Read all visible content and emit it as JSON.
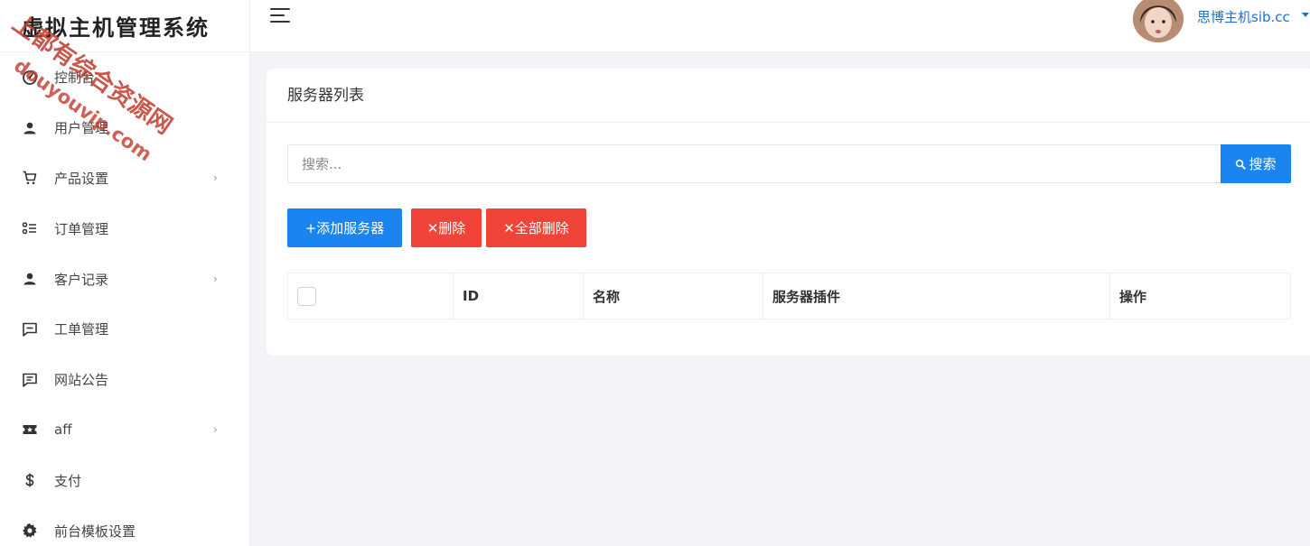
{
  "brand": {
    "title": "虚拟主机管理系统"
  },
  "watermark": {
    "line1": "上都有综合资源网",
    "line2": "douyouvip.com"
  },
  "sidebar": {
    "items": [
      {
        "label": "控制台",
        "icon": "dashboard-icon",
        "has_arrow": false
      },
      {
        "label": "用户管理",
        "icon": "user-icon",
        "has_arrow": false
      },
      {
        "label": "产品设置",
        "icon": "cart-icon",
        "has_arrow": true
      },
      {
        "label": "订单管理",
        "icon": "list-icon",
        "has_arrow": false
      },
      {
        "label": "客户记录",
        "icon": "user-icon",
        "has_arrow": true
      },
      {
        "label": "工单管理",
        "icon": "message-icon",
        "has_arrow": false
      },
      {
        "label": "网站公告",
        "icon": "notice-icon",
        "has_arrow": false
      },
      {
        "label": "aff",
        "icon": "ticket-icon",
        "has_arrow": true
      },
      {
        "label": "支付",
        "icon": "dollar-icon",
        "has_arrow": false
      },
      {
        "label": "前台模板设置",
        "icon": "gear-icon",
        "has_arrow": false
      }
    ],
    "arrow_glyph": "›"
  },
  "header": {
    "user_name": "思博主机sib.cc"
  },
  "main": {
    "card_title": "服务器列表",
    "search": {
      "placeholder": "搜索...",
      "button_label": "搜索"
    },
    "buttons": {
      "add_label": "+添加服务器",
      "delete_label": "✕删除",
      "delete_all_label": "✕全部删除"
    },
    "table": {
      "columns": [
        "ID",
        "名称",
        "服务器插件",
        "操作"
      ]
    }
  },
  "colors": {
    "primary": "#1a85f0",
    "danger": "#f04438",
    "link": "#1a72d9",
    "watermark": "#c0392b"
  }
}
